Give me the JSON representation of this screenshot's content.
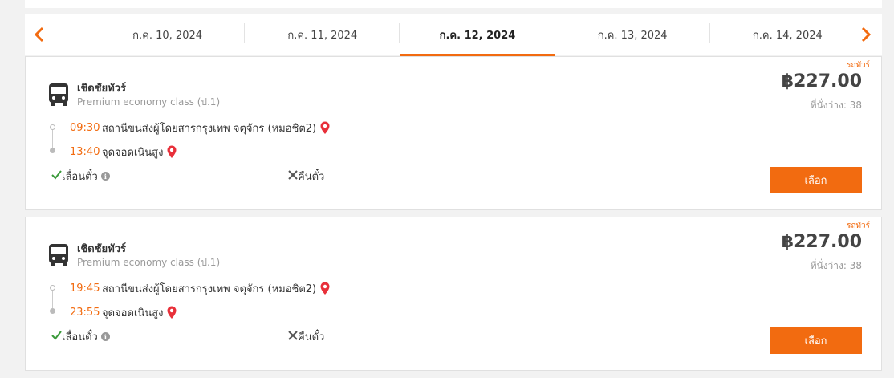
{
  "date_nav": {
    "prev_icon": "chevron-left-icon",
    "next_icon": "chevron-right-icon",
    "dates": [
      {
        "label": "ก.ค. 10, 2024",
        "active": false
      },
      {
        "label": "ก.ค. 11, 2024",
        "active": false
      },
      {
        "label": "ก.ค. 12, 2024",
        "active": true
      },
      {
        "label": "ก.ค. 13, 2024",
        "active": false
      },
      {
        "label": "ก.ค. 14, 2024",
        "active": false
      }
    ],
    "accent_color": "#f26b10"
  },
  "trips": [
    {
      "tag": "รถทัวร์",
      "operator": "เชิดชัยทัวร์",
      "bus_class": "Premium economy class (ป.1)",
      "departure_time": "09:30",
      "departure_station": "สถานีขนส่งผู้โดยสารกรุงเทพ จตุจักร (หมอชิต2)",
      "arrival_time": "13:40",
      "arrival_station": "จุดจอดเนินสูง",
      "change_label": "เลื่อนตั๋ว",
      "refund_label": "คืนตั๋ว",
      "price": "฿227.00",
      "seats": "ที่นั่งว่าง: 38",
      "select_label": "เลือก"
    },
    {
      "tag": "รถทัวร์",
      "operator": "เชิดชัยทัวร์",
      "bus_class": "Premium economy class (ป.1)",
      "departure_time": "19:45",
      "departure_station": "สถานีขนส่งผู้โดยสารกรุงเทพ จตุจักร (หมอชิต2)",
      "arrival_time": "23:55",
      "arrival_station": "จุดจอดเนินสูง",
      "change_label": "เลื่อนตั๋ว",
      "refund_label": "คืนตั๋ว",
      "price": "฿227.00",
      "seats": "ที่นั่งว่าง: 38",
      "select_label": "เลือก"
    }
  ],
  "icons": {
    "bus": "bus-icon",
    "pin": "map-pin-icon",
    "check": "check-icon",
    "info": "info-icon",
    "cross": "close-icon"
  }
}
